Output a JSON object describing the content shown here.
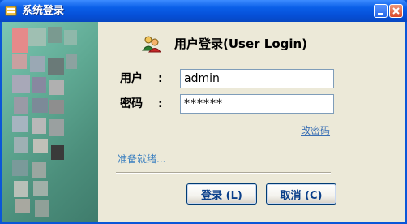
{
  "window": {
    "title": "系统登录",
    "minimize_label": "",
    "close_label": ""
  },
  "header": {
    "title": "用户登录(User Login)",
    "icon": "users-icon"
  },
  "form": {
    "user_label": "用户",
    "user_colon": ":",
    "user_value": "admin",
    "password_label": "密码",
    "password_colon": ":",
    "password_value": "******"
  },
  "links": {
    "change_password": "改密码"
  },
  "status": {
    "text": "准备就绪..."
  },
  "buttons": {
    "login": "登录 (L)",
    "cancel": "取消 (C)"
  }
}
